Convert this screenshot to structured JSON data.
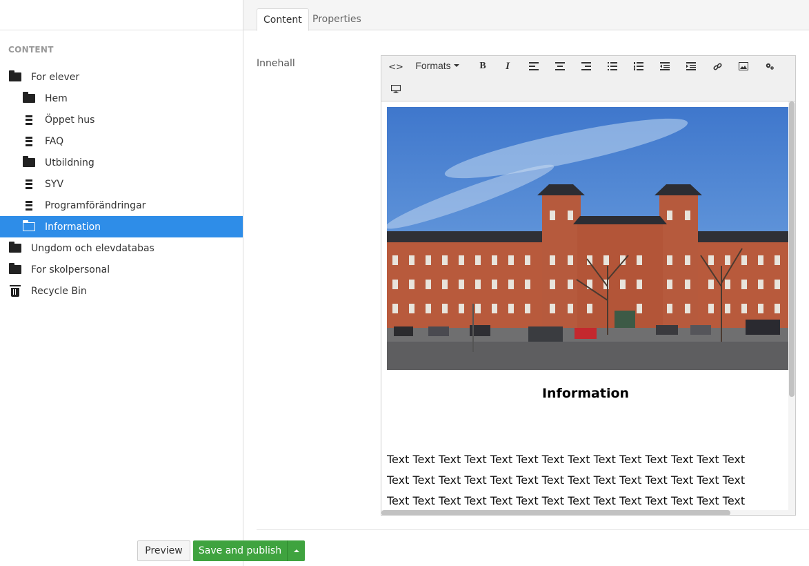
{
  "sidebar": {
    "section_label": "CONTENT",
    "items": [
      {
        "label": "For elever",
        "icon": "folder-icon",
        "level": 1
      },
      {
        "label": "Hem",
        "icon": "folder-icon",
        "level": 2
      },
      {
        "label": "Öppet hus",
        "icon": "document-icon",
        "level": 2
      },
      {
        "label": "FAQ",
        "icon": "document-icon",
        "level": 2
      },
      {
        "label": "Utbildning",
        "icon": "folder-icon",
        "level": 2
      },
      {
        "label": "SYV",
        "icon": "document-icon",
        "level": 2
      },
      {
        "label": "Programförändringar",
        "icon": "document-icon",
        "level": 2
      },
      {
        "label": "Information",
        "icon": "folder-open-icon",
        "level": 2,
        "selected": true
      },
      {
        "label": "Ungdom och elevdatabas",
        "icon": "folder-icon",
        "level": 1
      },
      {
        "label": "For skolpersonal",
        "icon": "folder-icon",
        "level": 1
      },
      {
        "label": "Recycle Bin",
        "icon": "trash-icon",
        "level": 1
      }
    ]
  },
  "tabs": {
    "content": "Content",
    "properties": "Properties"
  },
  "field": {
    "label": "Innehall"
  },
  "toolbar": {
    "source_code": "<>",
    "formats": "Formats",
    "bold": "B",
    "italic": "I"
  },
  "document": {
    "heading": "Information",
    "lines": [
      "Text Text Text Text Text Text Text Text Text Text Text Text Text Text",
      "Text Text Text Text Text Text Text Text Text Text Text Text Text Text",
      "Text Text Text Text Text Text Text Text Text Text Text Text Text Text"
    ]
  },
  "actions": {
    "preview": "Preview",
    "save_publish": "Save and publish"
  },
  "colors": {
    "selected_bg": "#2e8de8",
    "publish_green": "#3fa33f"
  }
}
